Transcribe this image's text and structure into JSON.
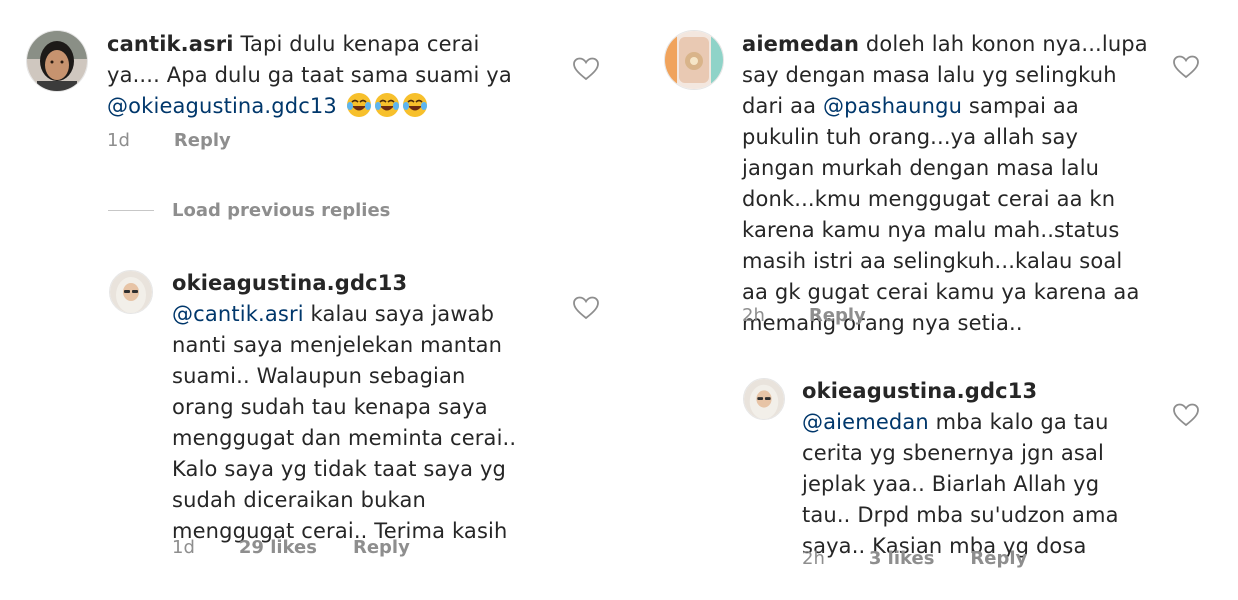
{
  "left": {
    "comment": {
      "username": "cantik.asri",
      "text_line1": " Tapi dulu kenapa cerai",
      "text_line2": "ya.... Apa dulu ga taat sama suami ya",
      "mention": "@okieagustina.gdc13",
      "time": "1d",
      "reply_label": "Reply"
    },
    "load_previous_label": "Load previous replies",
    "reply": {
      "username": "okieagustina.gdc13",
      "mention": "@cantik.asri",
      "text_first": " kalau saya jawab",
      "text_rest": "nanti saya menjelekan mantan\nsuami.. Walaupun sebagian\norang sudah tau kenapa saya\nmenggugat dan meminta cerai..\nKalo saya yg tidak taat saya yg\nsudah diceraikan bukan\nmenggugat cerai.. Terima kasih",
      "time": "1d",
      "likes": "29 likes",
      "reply_label": "Reply"
    }
  },
  "right": {
    "comment": {
      "username": "aiemedan",
      "text_line1": " doleh lah konon nya...lupa",
      "text_line2": "say dengan masa lalu yg selingkuh",
      "text_line3_pre": "dari aa ",
      "mention": "@pashaungu",
      "text_line3_post": " sampai aa",
      "text_rest": "pukulin tuh orang...ya allah say\njangan murkah dengan masa lalu\ndonk...kmu menggugat cerai aa kn\nkarena kamu nya malu mah..status\nmasih istri aa selingkuh...kalau soal\naa gk gugat cerai kamu ya karena aa\nmemang orang nya setia..",
      "time": "2h",
      "reply_label": "Reply"
    },
    "reply": {
      "username": "okieagustina.gdc13",
      "mention": "@aiemedan",
      "text_first": " mba kalo ga tau",
      "text_rest": "cerita yg sbenernya jgn asal\njeplak yaa.. Biarlah Allah yg\ntau.. Drpd mba su'udzon ama\nsaya.. Kasian mba yg dosa",
      "time": "2h",
      "likes": "3 likes",
      "reply_label": "Reply"
    }
  },
  "icons": {
    "like": "heart-outline-icon",
    "emoji": "face-with-tears-of-joy-emoji"
  },
  "colors": {
    "text": "#262626",
    "mention": "#00376b",
    "meta": "#8e8e8e"
  }
}
